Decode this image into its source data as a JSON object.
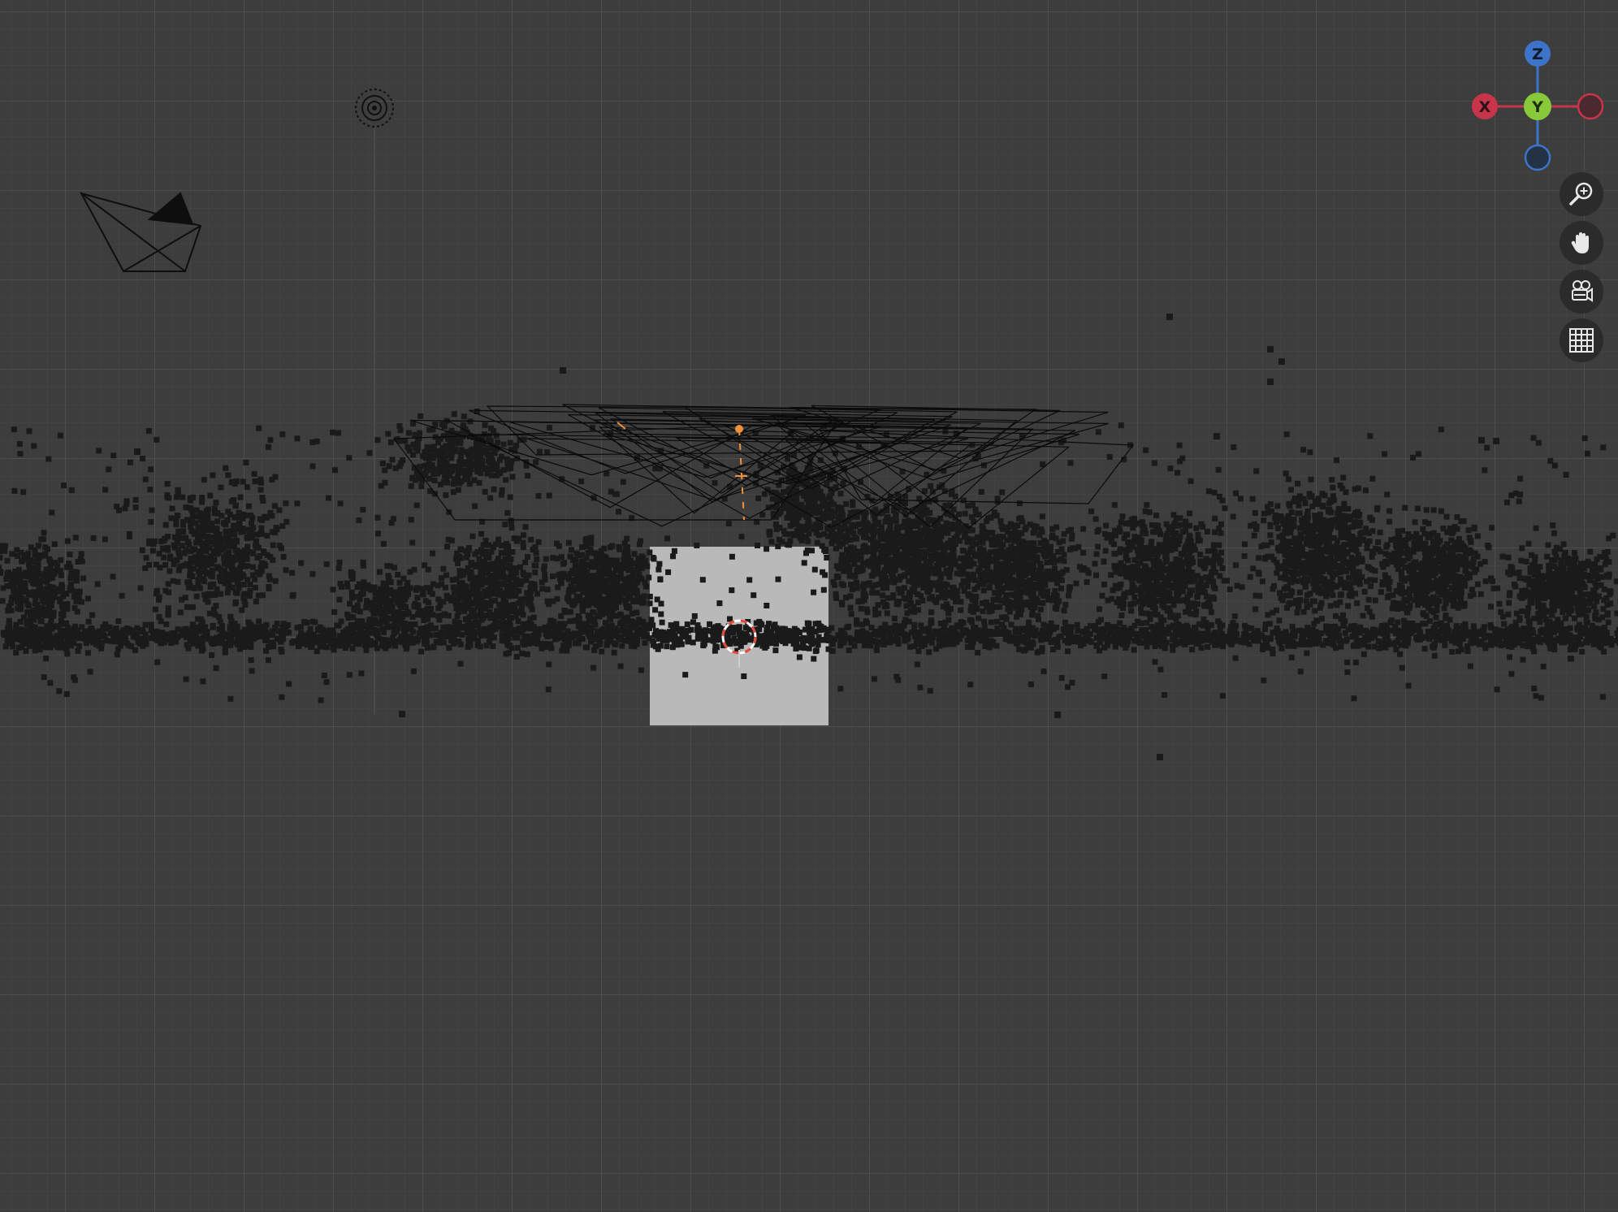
{
  "viewport": {
    "grid_color": "#505050",
    "background_color": "#3d3d3d"
  },
  "nav_gizmo": {
    "axis_z": {
      "label": "Z",
      "color": "#3d74c9"
    },
    "axis_x": {
      "label": "X",
      "color": "#c8354a"
    },
    "axis_y": {
      "label": "Y",
      "color": "#87c93b"
    },
    "axis_neg_x": {
      "color": "#c8354a"
    },
    "axis_neg_z": {
      "color": "#3d74c9"
    }
  },
  "nav_tools": [
    {
      "name": "zoom-icon"
    },
    {
      "name": "pan-hand-icon"
    },
    {
      "name": "camera-view-icon"
    },
    {
      "name": "grid-icon"
    }
  ],
  "scene": {
    "point_color": "#1a1a1a",
    "image_plane_color": "#b9b9b9",
    "selection_color": "#f0903a",
    "cursor_colors": [
      "#e04a3a",
      "#ffffff"
    ]
  }
}
